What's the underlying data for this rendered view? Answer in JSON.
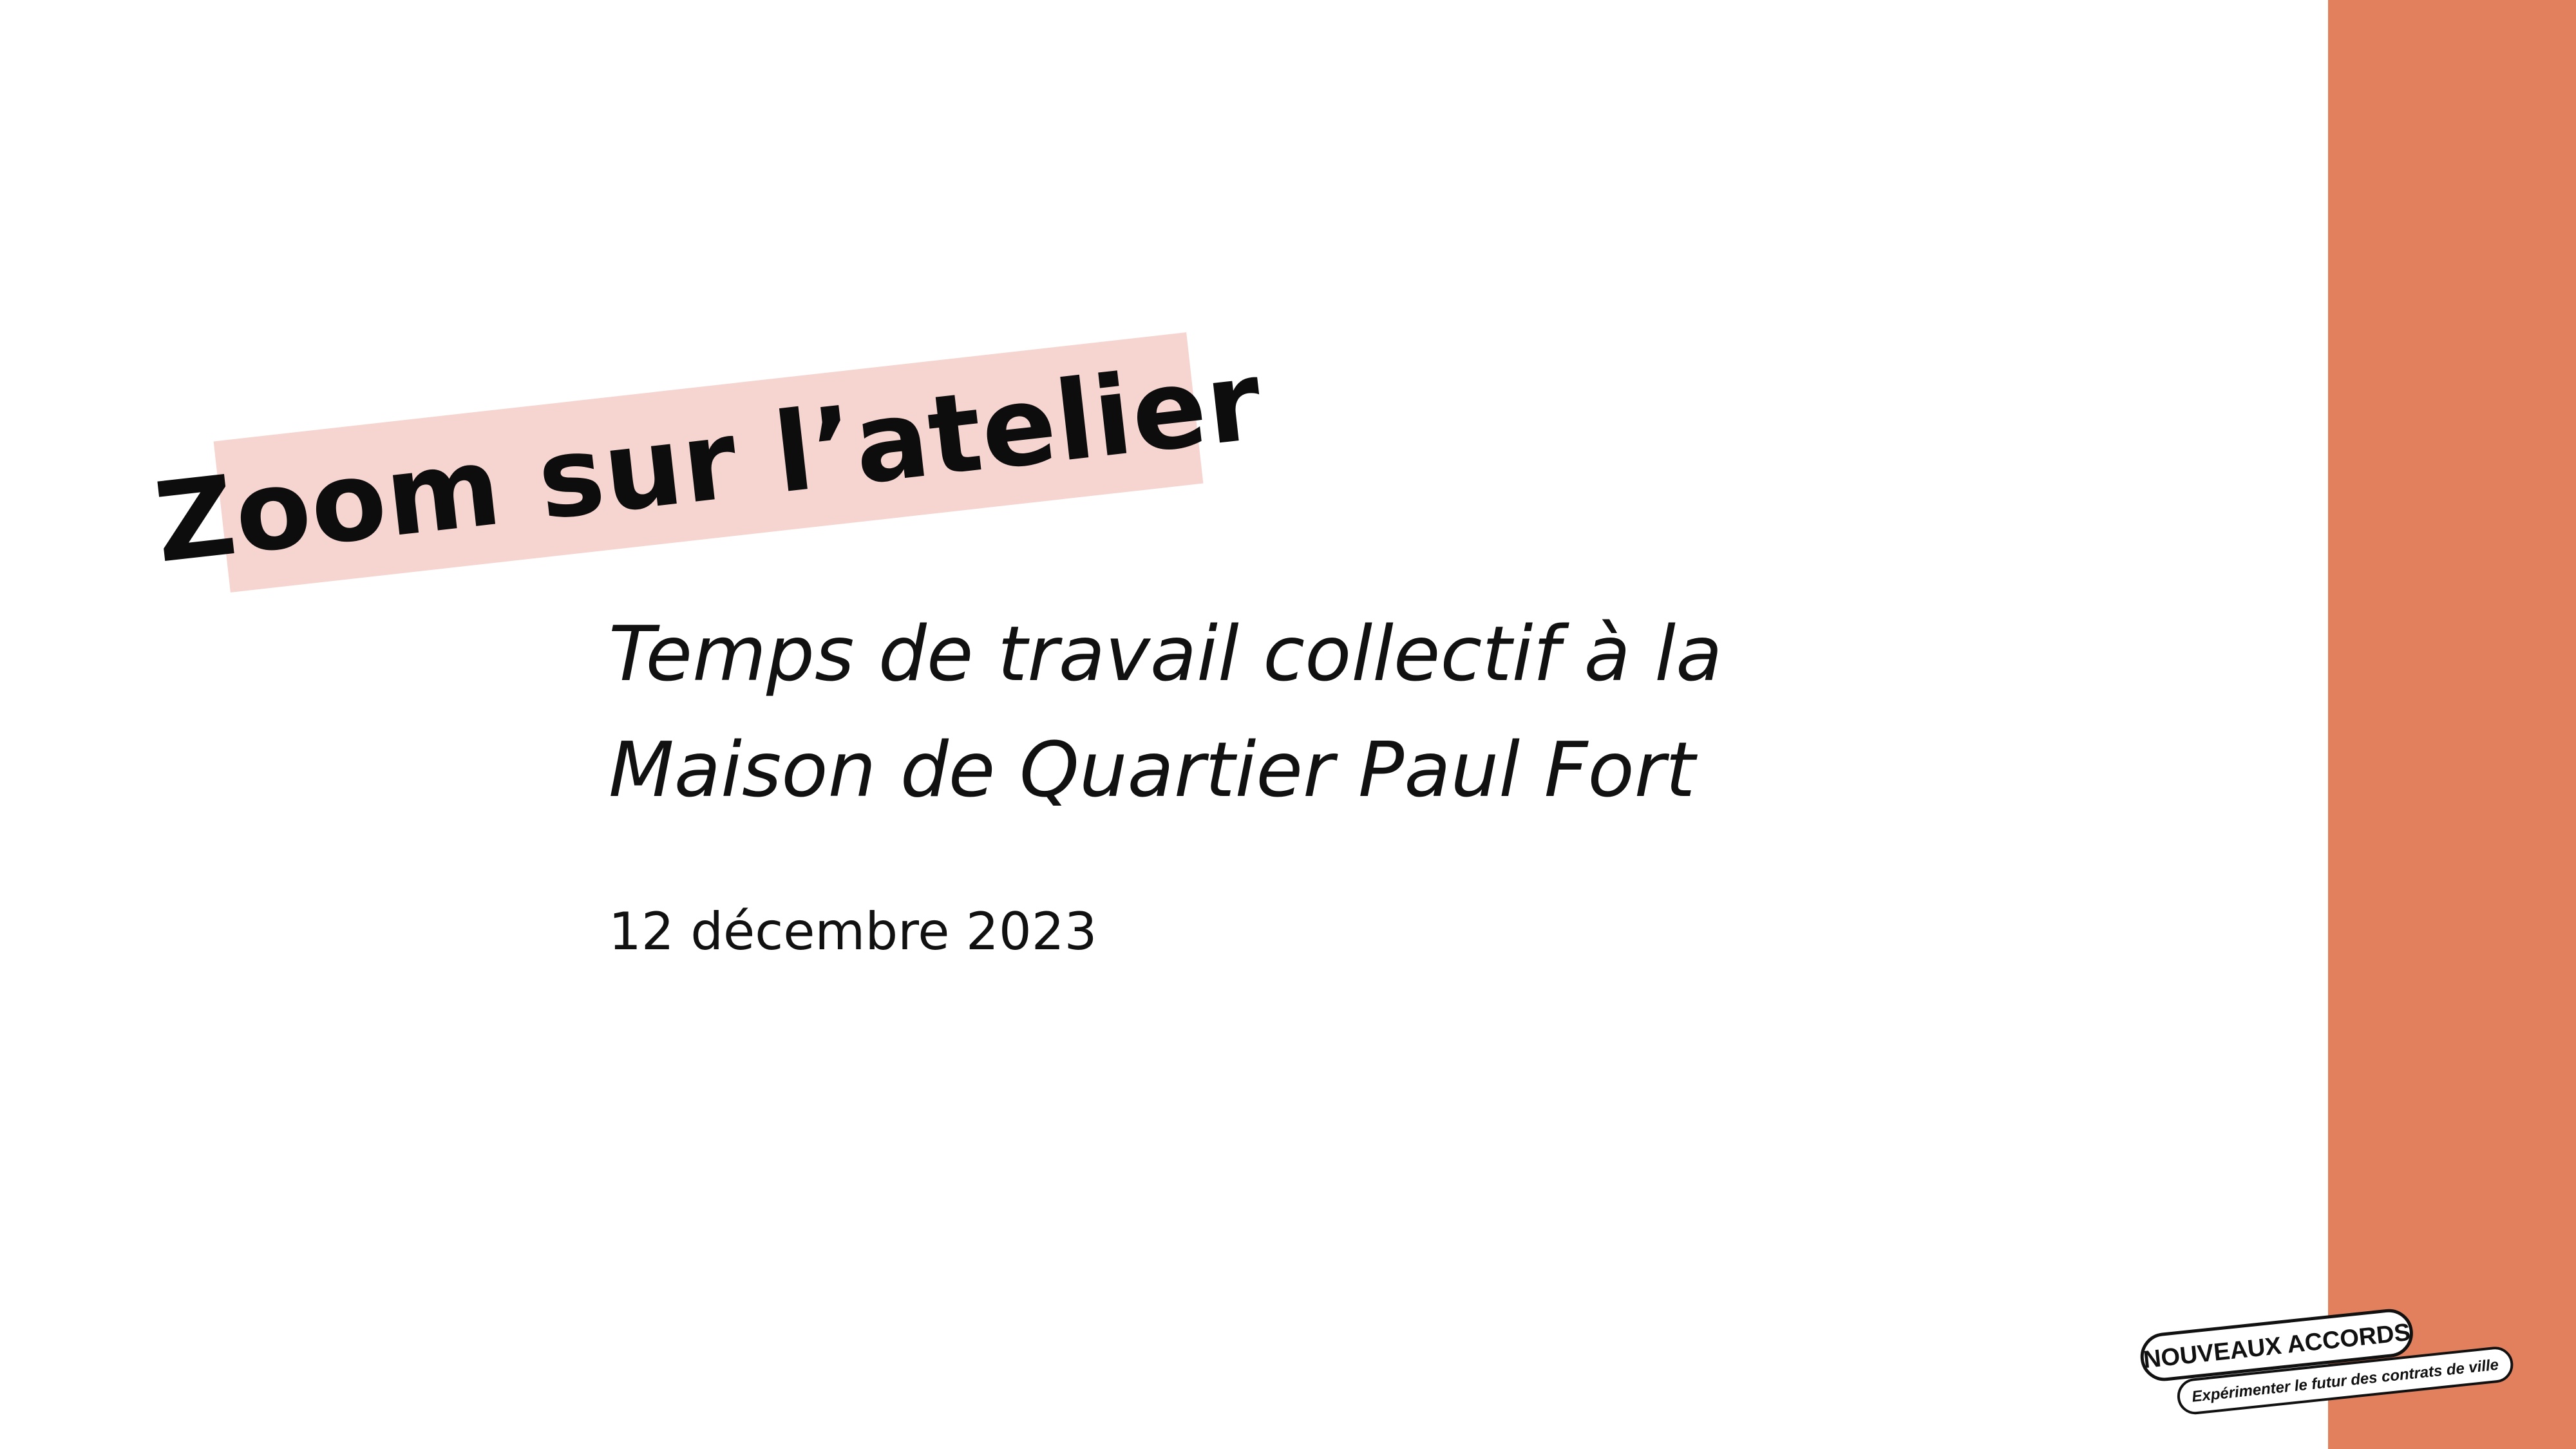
{
  "slide": {
    "title": "Zoom sur l’atelier",
    "subtitle_line1": "Temps de travail collectif à la",
    "subtitle_line2": "Maison de Quartier Paul Fort",
    "date": "12 décembre 2023"
  },
  "logo": {
    "name": "NOUVEAUX ACCORDS",
    "tagline": "Expérimenter le futur des contrats de ville"
  },
  "colors": {
    "accent_bar": "#e2805e",
    "title_band": "#f6d5d0",
    "text": "#111111"
  }
}
